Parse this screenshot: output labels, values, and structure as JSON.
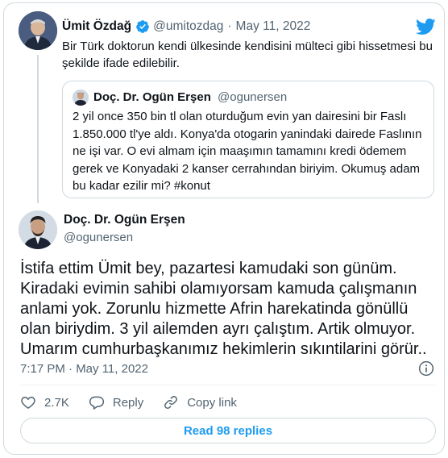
{
  "colors": {
    "accent": "#1d9bf0",
    "muted_text": "#536471",
    "border": "#cfd9de"
  },
  "parent_tweet": {
    "author_name": "Ümit Özdağ",
    "handle": "@umitozdag",
    "separator": "·",
    "date": "May 11, 2022",
    "text": "Bir Türk doktorun kendi ülkesinde kendisini mülteci gibi hissetmesi bu şekilde ifade edilebilir.",
    "verified_icon": "verified-badge-icon"
  },
  "quoted_tweet": {
    "author_name": "Doç. Dr. Ogün Erşen",
    "handle": "@ogunersen",
    "text": "2 yil once 350 bin tl olan oturduğum evin yan dairesini bir Faslı 1.850.000 tl'ye aldı. Konya'da otogarin yanindaki dairede Faslının ne işi var. O evi almam için maaşımın tamamını kredi ödemem gerek ve Konyadaki 2 kanser cerrahından biriyim. Okumuş adam bu kadar ezilir mi? #konut"
  },
  "main_tweet": {
    "author_name": "Doç. Dr. Ogün Erşen",
    "handle": "@ogunersen",
    "text": "İstifa ettim Ümit bey, pazartesi kamudaki son günüm. Kiradaki evimin sahibi olamıyorsam kamuda çalışmanın anlami yok. Zorunlu hizmette Afrin harekatinda gönüllü olan biriydim. 3 yil ailemden ayrı çalıştım. Artik olmuyor. Umarım cumhurbaşkanımız hekimlerin sıkıntilarini görür..",
    "timestamp": "7:17 PM · May 11, 2022"
  },
  "actions": {
    "like_count": "2.7K",
    "reply_label": "Reply",
    "copy_link_label": "Copy link"
  },
  "read_replies_label": "Read 98 replies"
}
